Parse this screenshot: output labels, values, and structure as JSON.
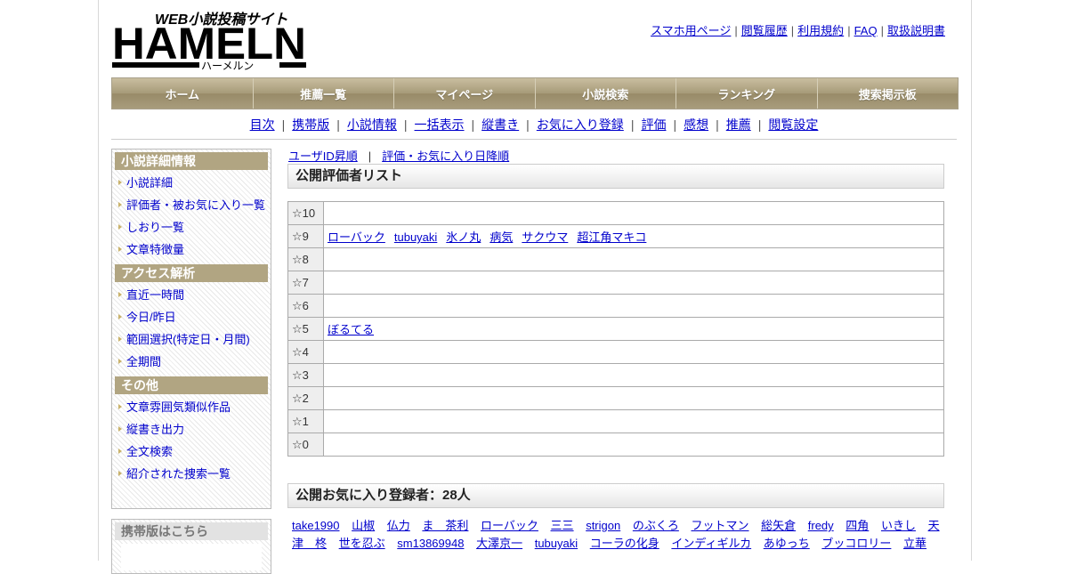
{
  "logo": {
    "tagline": "WEB小説投稿サイト",
    "brand": "HAMELN",
    "reading": "ハーメルン"
  },
  "toplinks": [
    "スマホ用ページ",
    "閲覧履歴",
    "利用規約",
    "FAQ",
    "取扱説明書"
  ],
  "gnav": [
    "ホーム",
    "推薦一覧",
    "マイページ",
    "小説検索",
    "ランキング",
    "捜索掲示板"
  ],
  "subnav": [
    "目次",
    "携帯版",
    "小説情報",
    "一括表示",
    "縦書き",
    "お気に入り登録",
    "評価",
    "感想",
    "推薦",
    "閲覧設定"
  ],
  "sidebar": {
    "sections": [
      {
        "title": "小説詳細情報",
        "items": [
          "小説詳細",
          "評価者・被お気に入り一覧",
          "しおり一覧",
          "文章特徴量"
        ]
      },
      {
        "title": "アクセス解析",
        "items": [
          "直近一時間",
          "今日/昨日",
          "範囲選択(特定日・月間)",
          "全期間"
        ]
      },
      {
        "title": "その他",
        "items": [
          "文章雰囲気類似作品",
          "縦書き出力",
          "全文検索",
          "紹介された捜索一覧"
        ]
      }
    ],
    "mobile_title": "携帯版はこちら"
  },
  "main": {
    "sort_links": [
      "ユーザID昇順",
      "評価・お気に入り日降順"
    ],
    "rating_title": "公開評価者リスト",
    "ratings": [
      {
        "label": "☆10",
        "names": []
      },
      {
        "label": "☆9",
        "names": [
          "ローバック",
          "tubuyaki",
          "氷ノ丸",
          "病気",
          "サクウマ",
          "超江角マキコ"
        ]
      },
      {
        "label": "☆8",
        "names": []
      },
      {
        "label": "☆7",
        "names": []
      },
      {
        "label": "☆6",
        "names": []
      },
      {
        "label": "☆5",
        "names": [
          "ぼるてる"
        ]
      },
      {
        "label": "☆4",
        "names": []
      },
      {
        "label": "☆3",
        "names": []
      },
      {
        "label": "☆2",
        "names": []
      },
      {
        "label": "☆1",
        "names": []
      },
      {
        "label": "☆0",
        "names": []
      }
    ],
    "fav_title": "公開お気に入り登録者：28人",
    "fav_names": [
      "take1990",
      "山椒",
      "仏力",
      "ま　茶利",
      "ローバック",
      "三三",
      "strigon",
      "のぶくろ",
      "フットマン",
      "総矢倉",
      "fredy",
      "四角",
      "いきし",
      "天津　柊",
      "世を忍ぶ",
      "sm13869948",
      "大澤京一",
      "tubuyaki",
      "コーラの化身",
      "インディギルカ",
      "あゆっち",
      "ブッコロリー",
      "立華"
    ]
  },
  "colors": {
    "nav_bg": "#a69a78",
    "side_head": "#b1a582",
    "link": "#0000cc"
  }
}
